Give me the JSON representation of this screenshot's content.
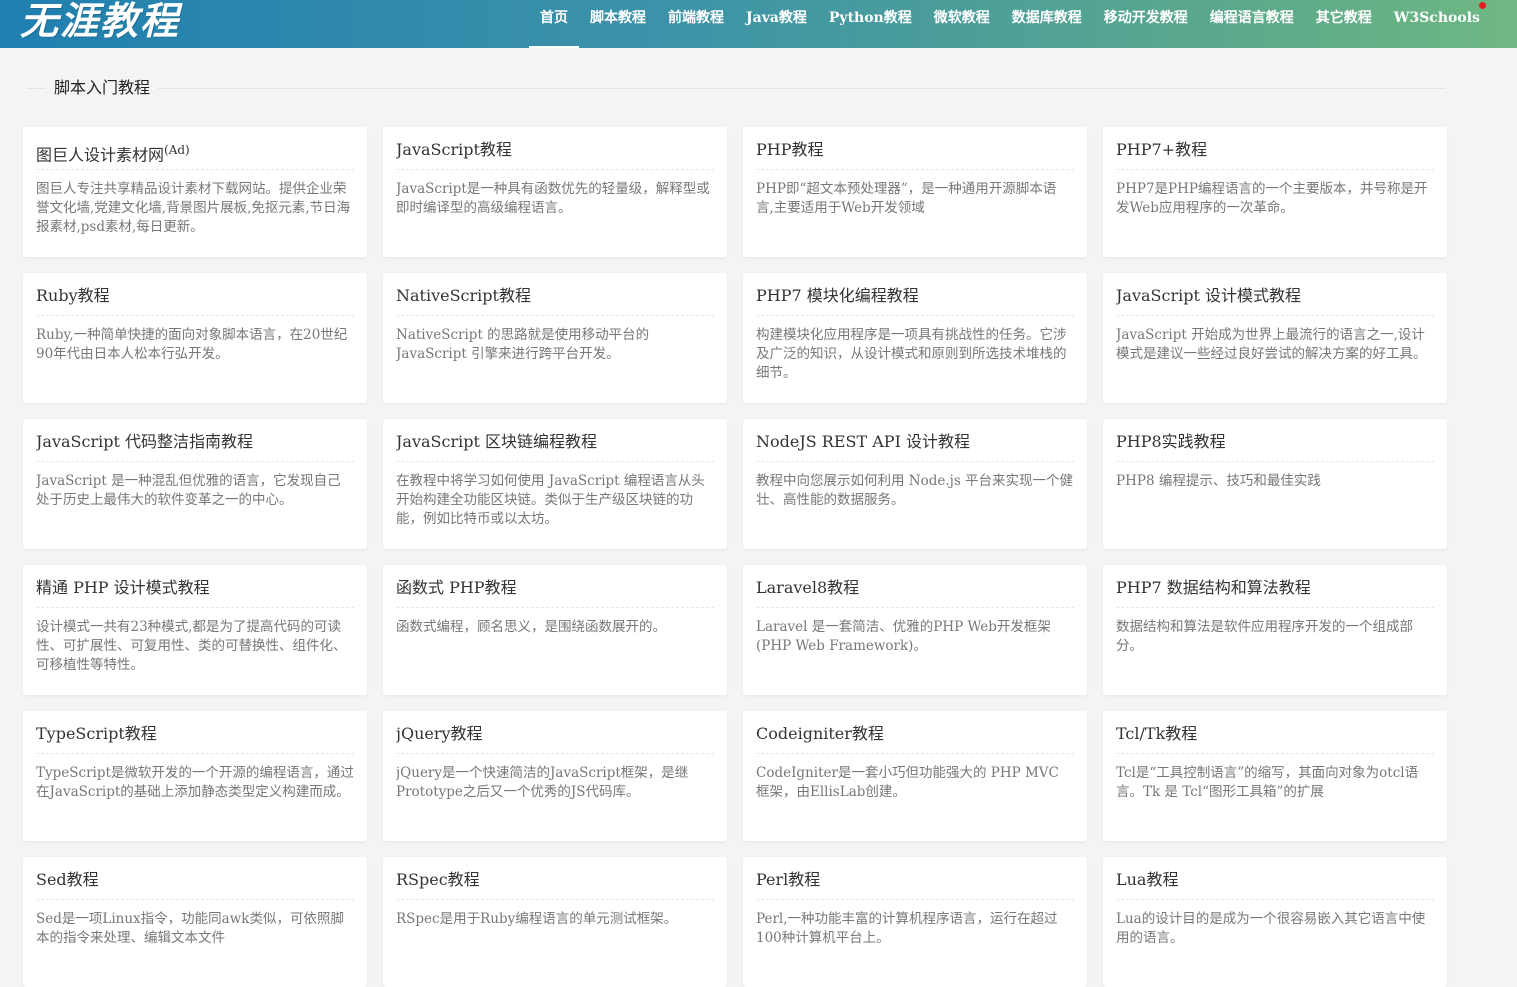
{
  "header": {
    "logo": "无涯教程",
    "nav": [
      {
        "label": "首页",
        "active": true
      },
      {
        "label": "脚本教程"
      },
      {
        "label": "前端教程"
      },
      {
        "label": "Java教程"
      },
      {
        "label": "Python教程"
      },
      {
        "label": "微软教程"
      },
      {
        "label": "数据库教程"
      },
      {
        "label": "移动开发教程"
      },
      {
        "label": "编程语言教程"
      },
      {
        "label": "其它教程"
      },
      {
        "label": "W3Schools",
        "badge_dot": true
      }
    ]
  },
  "section": {
    "title": "脚本入门教程"
  },
  "cards": [
    {
      "title": "图巨人设计素材网",
      "ad": "(Ad)",
      "desc": "图巨人专注共享精品设计素材下载网站。提供企业荣誉文化墙,党建文化墙,背景图片展板,免抠元素,节日海报素材,psd素材,每日更新。"
    },
    {
      "title": "JavaScript教程",
      "desc": "JavaScript是一种具有函数优先的轻量级，解释型或即时编译型的高级编程语言。"
    },
    {
      "title": "PHP教程",
      "desc": "PHP即“超文本预处理器”，是一种通用开源脚本语言,主要适用于Web开发领域"
    },
    {
      "title": "PHP7+教程",
      "desc": "PHP7是PHP编程语言的一个主要版本，并号称是开发Web应用程序的一次革命。"
    },
    {
      "title": "Ruby教程",
      "desc": "Ruby,一种简单快捷的面向对象脚本语言，在20世纪90年代由日本人松本行弘开发。"
    },
    {
      "title": "NativeScript教程",
      "desc": "NativeScript 的思路就是使用移动平台的 JavaScript 引擎来进行跨平台开发。"
    },
    {
      "title": "PHP7 模块化编程教程",
      "desc": "构建模块化应用程序是一项具有挑战性的任务。它涉及广泛的知识，从设计模式和原则到所选技术堆栈的细节。"
    },
    {
      "title": "JavaScript 设计模式教程",
      "desc": "JavaScript 开始成为世界上最流行的语言之一,设计模式是建议一些经过良好尝试的解决方案的好工具。"
    },
    {
      "title": "JavaScript 代码整洁指南教程",
      "desc": "JavaScript 是一种混乱但优雅的语言，它发现自己处于历史上最伟大的软件变革之一的中心。"
    },
    {
      "title": "JavaScript 区块链编程教程",
      "desc": "在教程中将学习如何使用 JavaScript 编程语言从头开始构建全功能区块链。类似于生产级区块链的功能，例如比特币或以太坊。"
    },
    {
      "title": "NodeJS REST API 设计教程",
      "desc": "教程中向您展示如何利用 Node.js 平台来实现一个健壮、高性能的数据服务。"
    },
    {
      "title": "PHP8实践教程",
      "desc": "PHP8 编程提示、技巧和最佳实践"
    },
    {
      "title": "精通 PHP 设计模式教程",
      "desc": "设计模式一共有23种模式,都是为了提高代码的可读性、可扩展性、可复用性、类的可替换性、组件化、可移植性等特性。"
    },
    {
      "title": "函数式 PHP教程",
      "desc": "函数式编程，顾名思义，是围绕函数展开的。"
    },
    {
      "title": "Laravel8教程",
      "desc": "Laravel 是一套简洁、优雅的PHP Web开发框架(PHP Web Framework)。"
    },
    {
      "title": "PHP7 数据结构和算法教程",
      "desc": "数据结构和算法是软件应用程序开发的一个组成部分。"
    },
    {
      "title": "TypeScript教程",
      "desc": "TypeScript是微软开发的一个开源的编程语言，通过在JavaScript的基础上添加静态类型定义构建而成。"
    },
    {
      "title": "jQuery教程",
      "desc": "jQuery是一个快速简洁的JavaScript框架，是继Prototype之后又一个优秀的JS代码库。"
    },
    {
      "title": "Codeigniter教程",
      "desc": "CodeIgniter是一套小巧但功能强大的 PHP MVC 框架，由EllisLab创建。"
    },
    {
      "title": "Tcl/Tk教程",
      "desc": "Tcl是“工具控制语言”的缩写，其面向对象为otcl语言。Tk 是 Tcl“图形工具箱”的扩展"
    },
    {
      "title": "Sed教程",
      "desc": "Sed是一项Linux指令，功能同awk类似，可依照脚本的指令来处理、编辑文本文件"
    },
    {
      "title": "RSpec教程",
      "desc": "RSpec是用于Ruby编程语言的单元测试框架。"
    },
    {
      "title": "Perl教程",
      "desc": "Perl,一种功能丰富的计算机程序语言，运行在超过100种计算机平台上。"
    },
    {
      "title": "Lua教程",
      "desc": "Lua的设计目的是成为一个很容易嵌入其它语言中使用的语言。"
    }
  ]
}
